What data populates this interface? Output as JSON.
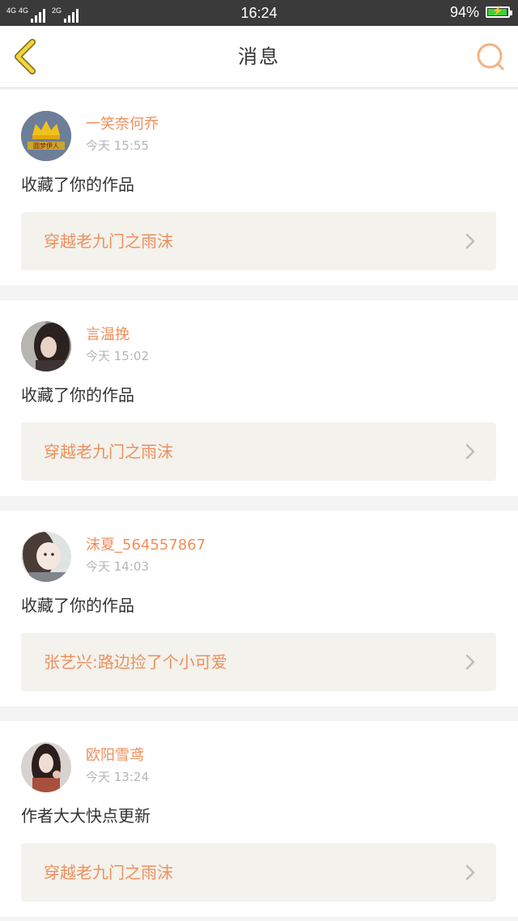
{
  "status_bar": {
    "network_1": "4G",
    "network_2": "4G",
    "network_3": "2G",
    "time": "16:24",
    "battery_percent": "94%",
    "battery_level": 0.94,
    "battery_color": "#3ad13a"
  },
  "header": {
    "title": "消息",
    "back_icon": "chevron-left-icon",
    "search_icon": "search-icon",
    "accent": "#f6b27e"
  },
  "messages": [
    {
      "username": "一笑奈何乔",
      "time": "今天 15:55",
      "action": "收藏了你的作品",
      "work_title": "穿越老九门之雨沫",
      "avatar_text": "圆梦伊人"
    },
    {
      "username": "言温挽",
      "time": "今天 15:02",
      "action": "收藏了你的作品",
      "work_title": "穿越老九门之雨沫"
    },
    {
      "username": "沫夏_564557867",
      "time": "今天 14:03",
      "action": "收藏了你的作品",
      "work_title": "张艺兴:路边捡了个小可爱"
    },
    {
      "username": "欧阳雪鸢",
      "time": "今天 13:24",
      "action": "作者大大快点更新",
      "work_title": "穿越老九门之雨沫"
    }
  ],
  "colors": {
    "username": "#ef8f5c",
    "work_title": "#ef8f5c",
    "link_background": "#f3f2ec"
  }
}
